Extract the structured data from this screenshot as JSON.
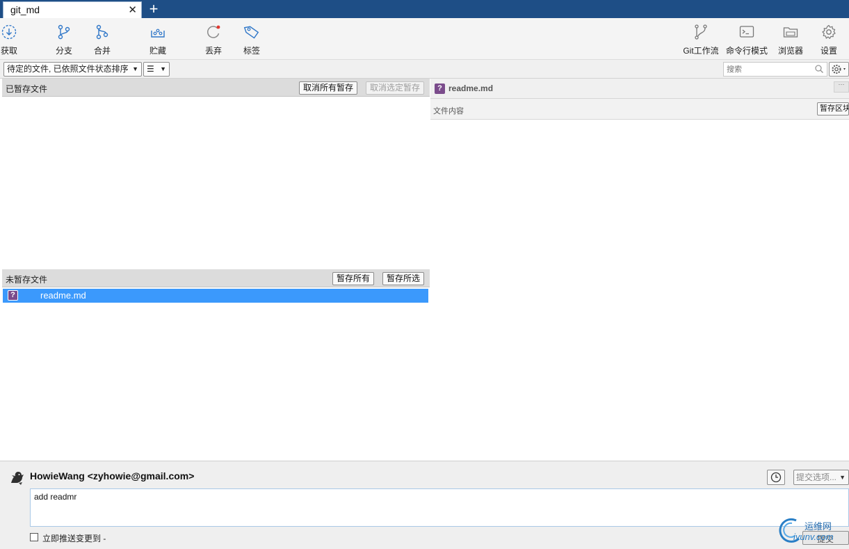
{
  "tab": {
    "title": "git_md",
    "close": "✕",
    "new_tab": "+"
  },
  "toolbar": {
    "fetch": "获取",
    "branch": "分支",
    "merge": "合并",
    "stash": "贮藏",
    "discard": "丢弃",
    "tag": "标签",
    "git_flow": "Git工作流",
    "terminal": "命令行模式",
    "explorer": "浏览器",
    "settings": "设置"
  },
  "filter": {
    "sort_mode": "待定的文件, 已依照文件状态排序",
    "view_mode_icon": "☰",
    "search_placeholder": "搜索"
  },
  "staged": {
    "title": "已暂存文件",
    "unstage_all": "取消所有暂存",
    "unstage_selected": "取消选定暂存",
    "files": []
  },
  "unstaged": {
    "title": "未暂存文件",
    "stage_all": "暂存所有",
    "stage_selected": "暂存所选",
    "files": [
      {
        "name": "readme.md",
        "status": "?"
      }
    ]
  },
  "diff": {
    "status": "?",
    "filename": "readme.md",
    "section_label": "文件内容",
    "stage_hunk": "暂存区块"
  },
  "commit": {
    "author": "HowieWang <zyhowie@gmail.com>",
    "message": "add readmr",
    "push_label": "立即推送变更到 -",
    "options": "提交选项...",
    "submit": "提交"
  },
  "watermark": {
    "cn": "运维网",
    "en": "iyunv.com"
  },
  "colors": {
    "titlebar": "#1e4e86",
    "selection": "#3b99fc",
    "accent_icon": "#2e76c8",
    "status_badge": "#7b4c8c",
    "discard_dot": "#e2382f"
  }
}
